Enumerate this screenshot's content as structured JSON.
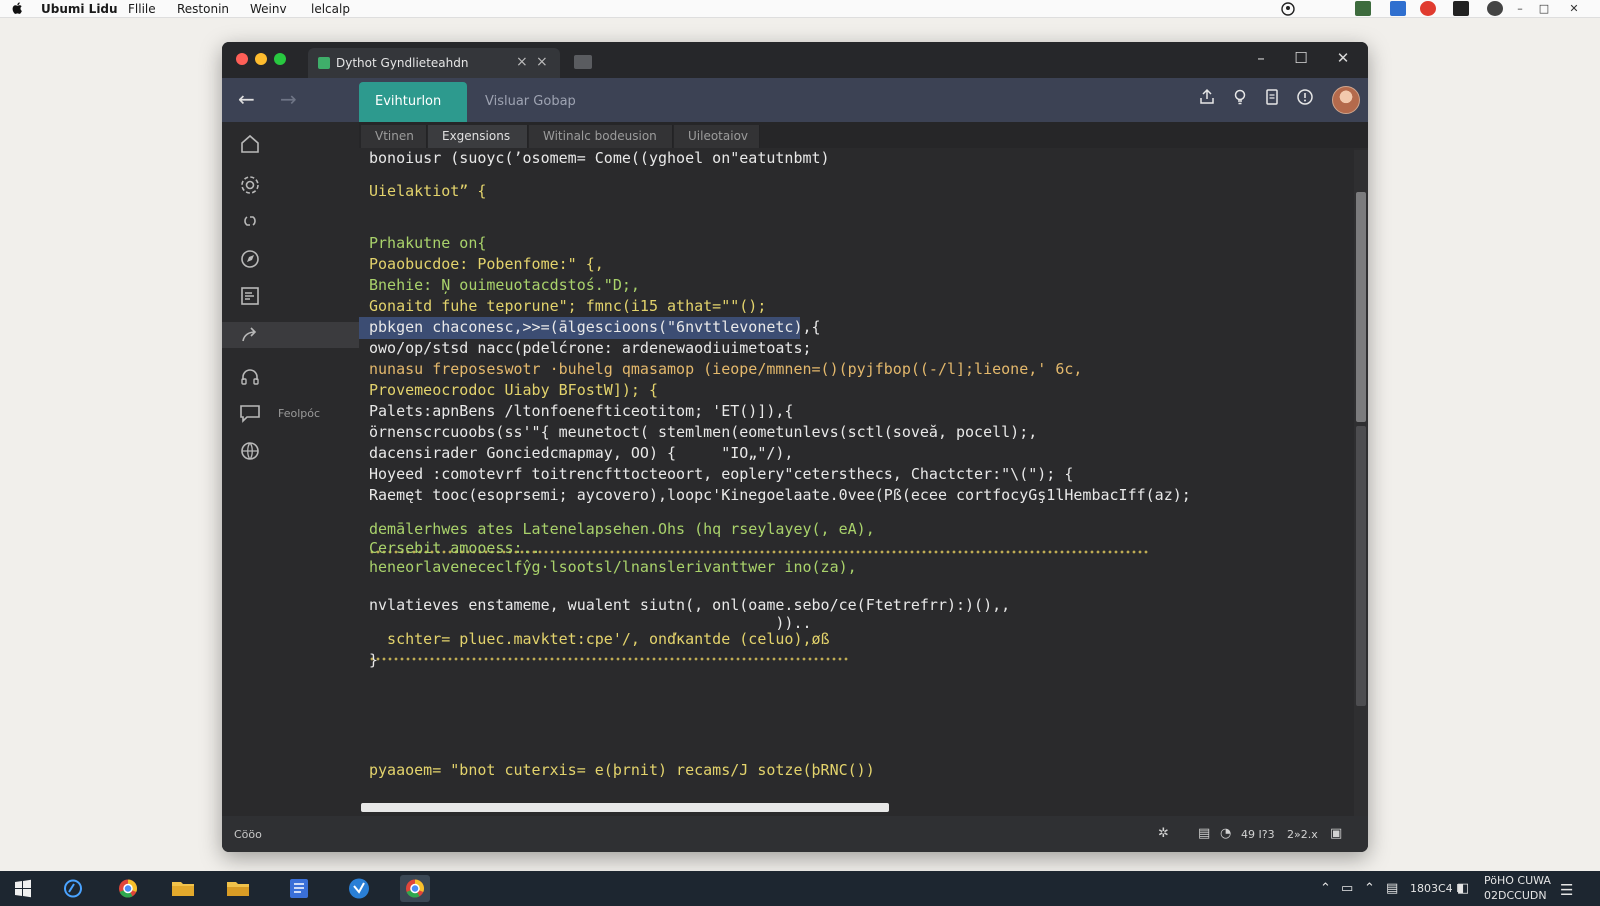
{
  "os_menubar": {
    "app_name": "Ubumi Lidu",
    "menus": [
      "Fllile",
      "Restonin",
      "Weinv",
      "lelcalp"
    ]
  },
  "window": {
    "tab_title": "Dythot Gyndlieteahdn",
    "tab_close": "×",
    "nav_tabs": [
      "Evihturlon",
      "Visluar Gobap"
    ],
    "editor_tabs": [
      "Vtinen",
      "Exgensions",
      "Witinalc bodeusion",
      "Uileotaiov"
    ],
    "active_editor_tab": "Exgensions",
    "sidebar": [
      {
        "icon": "home-icon",
        "label": ""
      },
      {
        "icon": "gear-icon",
        "label": ""
      },
      {
        "icon": "link-icon",
        "label": ""
      },
      {
        "icon": "compass-icon",
        "label": ""
      },
      {
        "icon": "list-icon",
        "label": ""
      },
      {
        "icon": "redirect-icon",
        "label": ""
      },
      {
        "icon": "headset-icon",
        "label": ""
      },
      {
        "icon": "chat-icon",
        "label": "Feolpóc"
      },
      {
        "icon": "globe-icon",
        "label": ""
      }
    ]
  },
  "code": [
    {
      "text": "bonoiusr (suoyc(’osomem= Come((yghoel on\"eatutnbmt)",
      "color": "#e8e8e8"
    },
    {
      "text": "",
      "color": "#e8e8e8"
    },
    {
      "text": "Uielaktiot” {",
      "color": "#e3d36c"
    },
    {
      "text": "",
      "color": "#e8e8e8"
    },
    {
      "text": "",
      "color": "#e8e8e8"
    },
    {
      "text": "Prhakutne on{",
      "color": "#a9d26b"
    },
    {
      "text": "Poaobucdoe: Pobenfome:\" {,",
      "color": "#e3d36c"
    },
    {
      "text": "Bnehie: Ņ ouimeuotacdstoś.\"D;,",
      "color": "#a9d26b"
    },
    {
      "text": "Gonaitd fuhe teporune\"; fmnc(i15 athat=\"\"();",
      "color": "#e3d36c"
    },
    {
      "text": "pbkgen chaconesc,>>=(ālgescioons(\"6nvttlevonetc),{",
      "color": "#e8e8e8"
    },
    {
      "text": "owo/op/stsd nacc(pdelćrone: ardenewaodiuimetoats;",
      "color": "#e8e8e8"
    },
    {
      "text": "nunasu freposeswotr ·buhelg qmasamop (ieope/mmnen=()(pyjfbop((-/l];lieone,' 6c,",
      "color": "#e3b86c"
    },
    {
      "text": "Provemeocrodoc Uiaby BFostW]); {",
      "color": "#e3d36c"
    },
    {
      "text": "Palets:apnBens /ltonfoenefticeotitom; 'ET()]),{",
      "color": "#e8e8e8"
    },
    {
      "text": "örnenscrcuoobs(ss'\"{ meunetoct( stemlmen(eometunlevs(sctl(soveă, pocell);,",
      "color": "#e8e8e8"
    },
    {
      "text": "dacensirader Gonciedcmapmay, OO) {     \"IO„\"/),",
      "color": "#e8e8e8"
    },
    {
      "text": "Hoyeed :comotevrf toitrencfttocteoort, eoplery\"cetersthecs, Chactcter:\"\\(\"); {",
      "color": "#e8e8e8"
    },
    {
      "text": "Raemęt tooc(esoprsemi; aycovero),loopc'Kinegoelaate.0vee(Pß(ecee cortfocyGş1lHembacIff(az);",
      "color": "#e8e8e8"
    },
    {
      "text": "",
      "color": "#e8e8e8"
    },
    {
      "text": "demālerhwes ates Latenelapsehen.Ohs (hq rseylayey(, eA),",
      "color": "#a9d26b"
    },
    {
      "text": "Cersebit amooess:..",
      "color": "#a9d26b"
    },
    {
      "text": "heneorlavenececlfŷg·lsootsl/lnanslerivanttwer ino(za),",
      "color": "#a9d26b"
    },
    {
      "text": "",
      "color": "#e8e8e8"
    },
    {
      "text": "nvlatieves enstameme, wualent siutn(, onl(oame.sebo/ce(Ftetrefrr):)(),,",
      "color": "#e8e8e8"
    },
    {
      "text": "                                             ))..",
      "color": "#e8e8e8"
    },
    {
      "text": "  schter= pluec.mavktet:cpe'/, onďĸantde (celuo),øß",
      "color": "#e3d36c"
    },
    {
      "text": "}",
      "color": "#e8e8e8"
    },
    {
      "text": "pyaaoem= \"bnot cuterxis= e(þrnit) recams/J sotze(þRNC())",
      "color": "#e3d36c"
    }
  ],
  "statusbar": {
    "left": "Cööo",
    "right_text": "49 I?3",
    "position": "2»2.x"
  },
  "taskbar": {
    "clock_top": "PöHO CUWA",
    "clock_bottom": "02DCCUDN",
    "tray_text": "1803C4 I"
  }
}
